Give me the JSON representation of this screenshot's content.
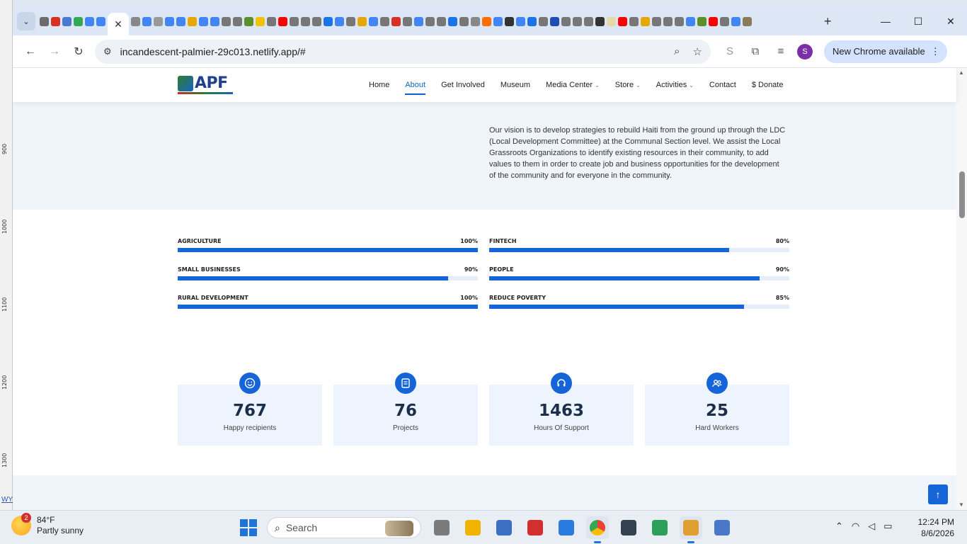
{
  "ruler": {
    "ticks": [
      "900",
      "1000",
      "1100",
      "1200",
      "1300"
    ],
    "link_text": "WY"
  },
  "browser": {
    "new_tab_glyph": "+",
    "active_tab_close": "✕",
    "window_controls": {
      "minimize": "—",
      "maximize": "☐",
      "close": "✕"
    },
    "url": "incandescent-palmier-29c013.netlify.app/#",
    "update_button": "New Chrome available",
    "profile_initial": "S",
    "favicons": [
      "#6b6b6b",
      "#d93025",
      "#4a7bd0",
      "#34a853",
      "#4285f4",
      "#4285f4",
      "#888",
      "#4285f4",
      "#999",
      "#4285f4",
      "#4285f4",
      "#e6a700",
      "#4285f4",
      "#4285f4",
      "#777",
      "#777",
      "#5a8f2a",
      "#f2c200",
      "#777",
      "#ff0000",
      "#777",
      "#777",
      "#777",
      "#1a73e8",
      "#4285f4",
      "#777",
      "#e6a700",
      "#4285f4",
      "#777",
      "#d93025",
      "#777",
      "#4285f4",
      "#777",
      "#777",
      "#1a73e8",
      "#777",
      "#888",
      "#ff6d00",
      "#4285f4",
      "#333",
      "#4285f4",
      "#1a73e8",
      "#777",
      "#1f4eb0",
      "#777",
      "#777",
      "#777",
      "#333",
      "#e6d9a8",
      "#ff0000",
      "#777",
      "#e6a700",
      "#777",
      "#777",
      "#777",
      "#4285f4",
      "#5a8f2a",
      "#ff0000",
      "#777",
      "#4285f4",
      "#8a7a5a"
    ]
  },
  "site": {
    "logo_text": "APF",
    "nav": [
      {
        "label": "Home"
      },
      {
        "label": "About"
      },
      {
        "label": "Get Involved"
      },
      {
        "label": "Museum"
      },
      {
        "label": "Media Center"
      },
      {
        "label": "Store"
      },
      {
        "label": "Activities"
      },
      {
        "label": "Contact"
      },
      {
        "label": "$ Donate"
      }
    ],
    "nav_active": "About",
    "vision": "Our vision is to develop strategies to rebuild Haiti from the ground up through the LDC (Local Development Committee) at the Communal Section level. We assist the Local Grassroots Organizations to identify existing resources in their community, to add values to them in order to create job and business opportunities for the development of the community and for everyone in the community.",
    "skills": [
      {
        "label": "AGRICULTURE",
        "percent_text": "100%",
        "value": 100
      },
      {
        "label": "FINTECH",
        "percent_text": "80%",
        "value": 80
      },
      {
        "label": "SMALL BUSINESSES",
        "percent_text": "90%",
        "value": 90
      },
      {
        "label": "PEOPLE",
        "percent_text": "90%",
        "value": 90
      },
      {
        "label": "RURAL DEVELOPMENT",
        "percent_text": "100%",
        "value": 100
      },
      {
        "label": "REDUCE POVERTY",
        "percent_text": "85%",
        "value": 85
      }
    ],
    "stats": [
      {
        "number": "767",
        "label": "Happy recipients",
        "icon": "smile-icon"
      },
      {
        "number": "76",
        "label": "Projects",
        "icon": "notebook-icon"
      },
      {
        "number": "1463",
        "label": "Hours Of Support",
        "icon": "headset-icon"
      },
      {
        "number": "25",
        "label": "Hard Workers",
        "icon": "people-icon"
      }
    ],
    "accent_color": "#1565d8"
  },
  "taskbar": {
    "weather_badge": "2",
    "temperature": "84°F",
    "condition": "Partly sunny",
    "search_placeholder": "Search",
    "time": "12:24 PM",
    "date": "8/6/2026",
    "apps": [
      "task-view",
      "file-explorer",
      "ftp-client",
      "game-app",
      "notepad",
      "chrome",
      "media-app",
      "sheets-app",
      "colorful-app",
      "calendar-app"
    ]
  }
}
